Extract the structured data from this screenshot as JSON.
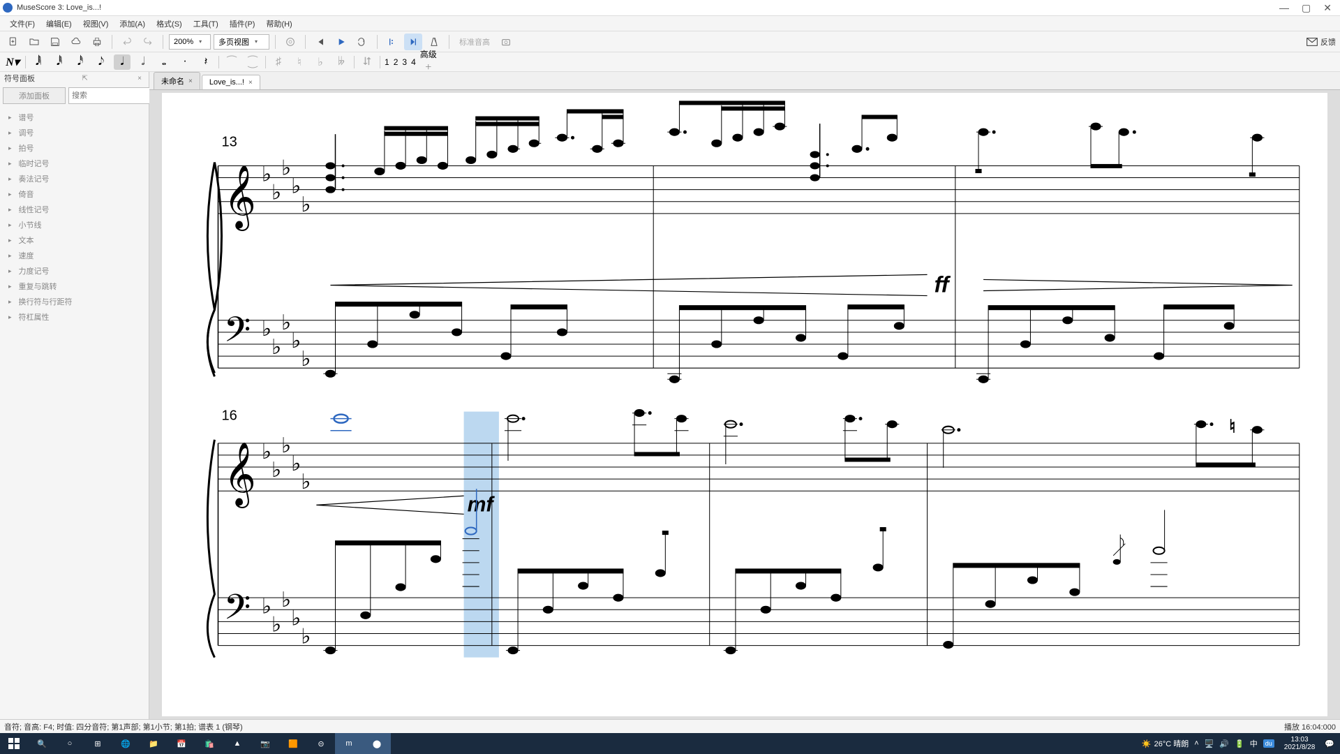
{
  "titlebar": {
    "title": "MuseScore 3: Love_is...!"
  },
  "menu": [
    "文件(F)",
    "编辑(E)",
    "视图(V)",
    "添加(A)",
    "格式(S)",
    "工具(T)",
    "插件(P)",
    "帮助(H)"
  ],
  "toolbar": {
    "zoom": "200%",
    "view_mode": "多页视图",
    "tuning_label": "标准音高",
    "feedback": "反馈",
    "advanced": "高级"
  },
  "voices": [
    "1",
    "2",
    "3",
    "4"
  ],
  "active_voice": 0,
  "palette": {
    "title": "符号面板",
    "add_label": "添加面板",
    "search_placeholder": "搜索",
    "items": [
      "谱号",
      "调号",
      "拍号",
      "临时记号",
      "奏法记号",
      "倚音",
      "线性记号",
      "小节线",
      "文本",
      "速度",
      "力度记号",
      "重复与跳转",
      "换行符与行距符",
      "符杠属性"
    ]
  },
  "tabs": [
    {
      "label": "未命名",
      "active": false
    },
    {
      "label": "Love_is...!",
      "active": true
    }
  ],
  "score": {
    "measure_numbers": [
      "13",
      "16"
    ],
    "dynamics": {
      "ff": "ff",
      "mf": "mf"
    }
  },
  "statusbar": {
    "left": "音符; 音高: F4; 时值: 四分音符; 第1声部; 第1小节; 第1拍; 谱表 1 (钢琴)",
    "right": "播放  16:04:000"
  },
  "taskbar": {
    "weather": "26°C 晴朗",
    "ime": "中",
    "time": "13:03",
    "date": "2021/8/28"
  }
}
